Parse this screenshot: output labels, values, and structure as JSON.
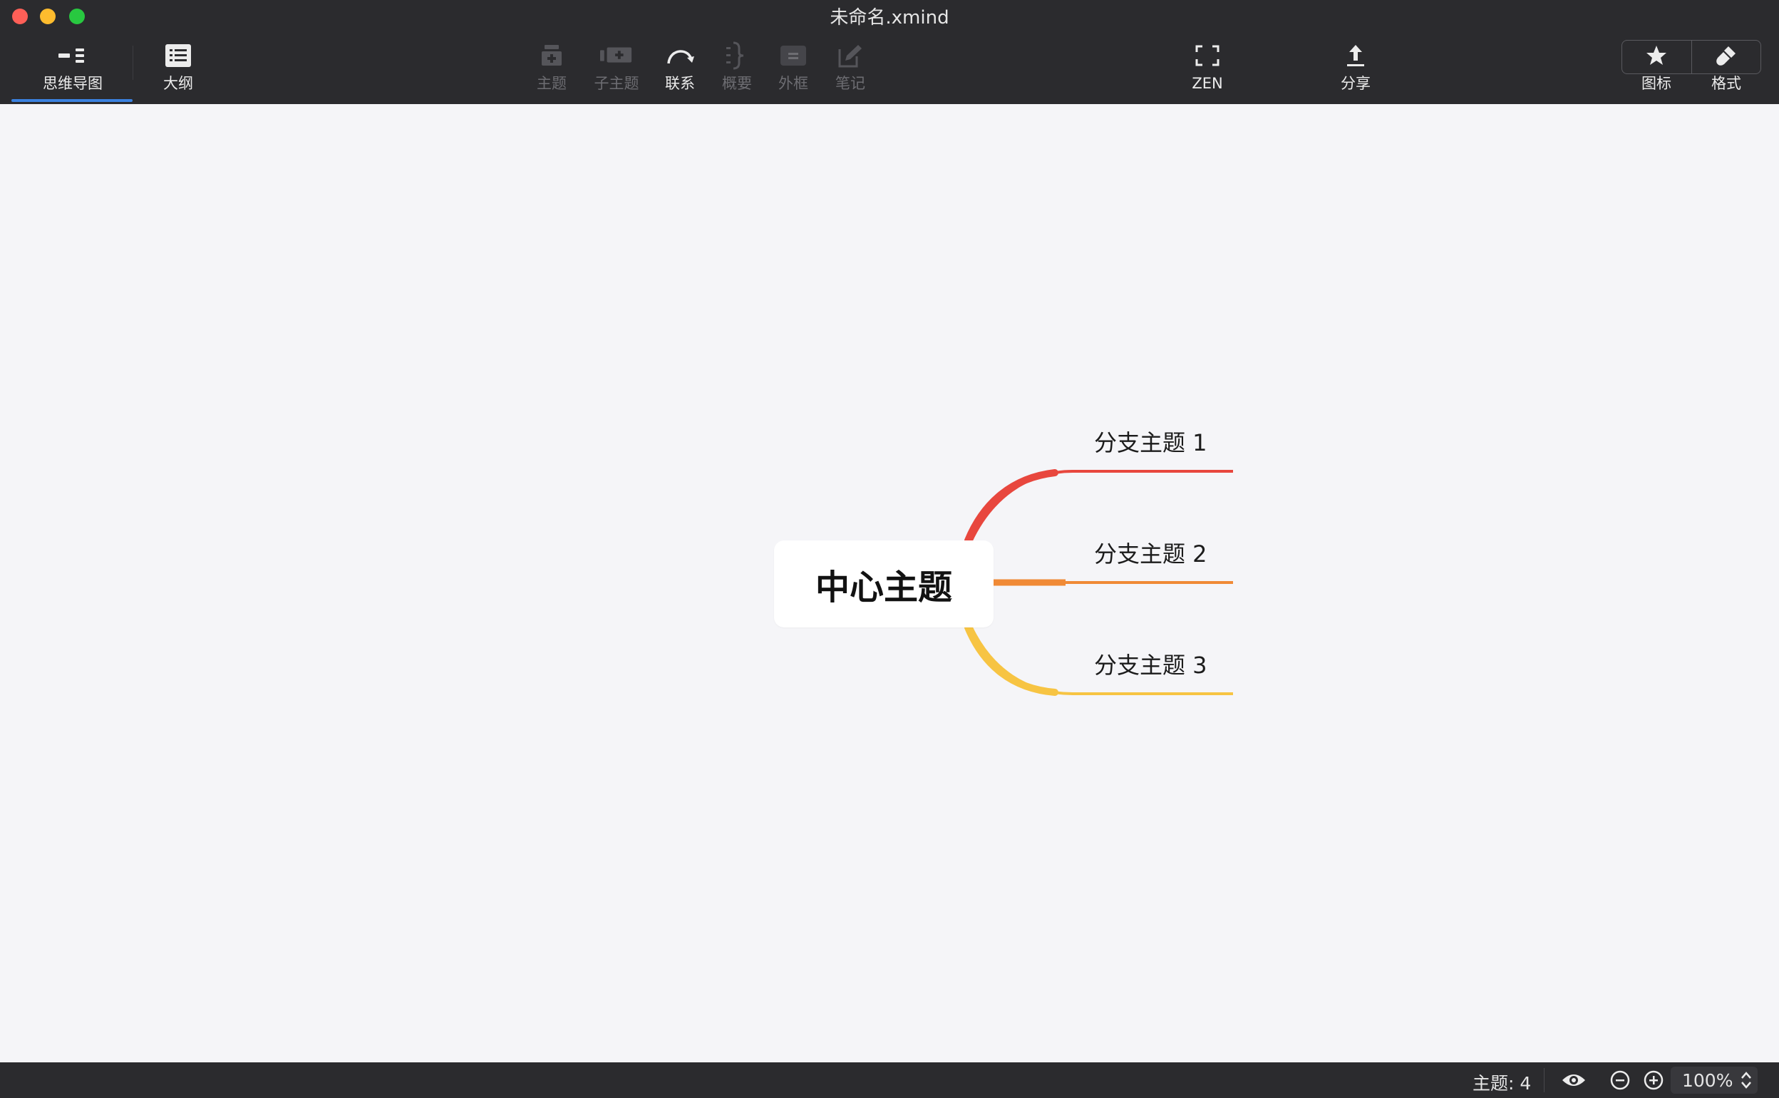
{
  "window": {
    "title": "未命名.xmind"
  },
  "toolbar": {
    "tabs": [
      {
        "label": "思维导图",
        "icon": "mindmap-icon",
        "active": true
      },
      {
        "label": "大纲",
        "icon": "outline-icon",
        "active": false
      }
    ],
    "insert_tools": [
      {
        "label": "主题",
        "icon": "topic-icon",
        "enabled": false
      },
      {
        "label": "子主题",
        "icon": "subtopic-icon",
        "enabled": false
      },
      {
        "label": "联系",
        "icon": "relationship-icon",
        "enabled": true
      },
      {
        "label": "概要",
        "icon": "summary-icon",
        "enabled": false
      },
      {
        "label": "外框",
        "icon": "boundary-icon",
        "enabled": false
      },
      {
        "label": "笔记",
        "icon": "note-icon",
        "enabled": false
      }
    ],
    "zen_label": "ZEN",
    "share_label": "分享",
    "panel_tabs": [
      {
        "label": "图标",
        "icon": "star-icon"
      },
      {
        "label": "格式",
        "icon": "brush-icon"
      }
    ]
  },
  "mindmap": {
    "central_topic": "中心主题",
    "branches": [
      {
        "label": "分支主题 1",
        "color": "#e8473e"
      },
      {
        "label": "分支主题 2",
        "color": "#f08a36"
      },
      {
        "label": "分支主题 3",
        "color": "#f7c443"
      }
    ]
  },
  "statusbar": {
    "topic_count": "主题: 4",
    "zoom": "100%"
  },
  "colors": {
    "toolbar_bg": "#2b2b2e",
    "canvas_bg": "#f5f5f8",
    "accent": "#3b82e0"
  }
}
